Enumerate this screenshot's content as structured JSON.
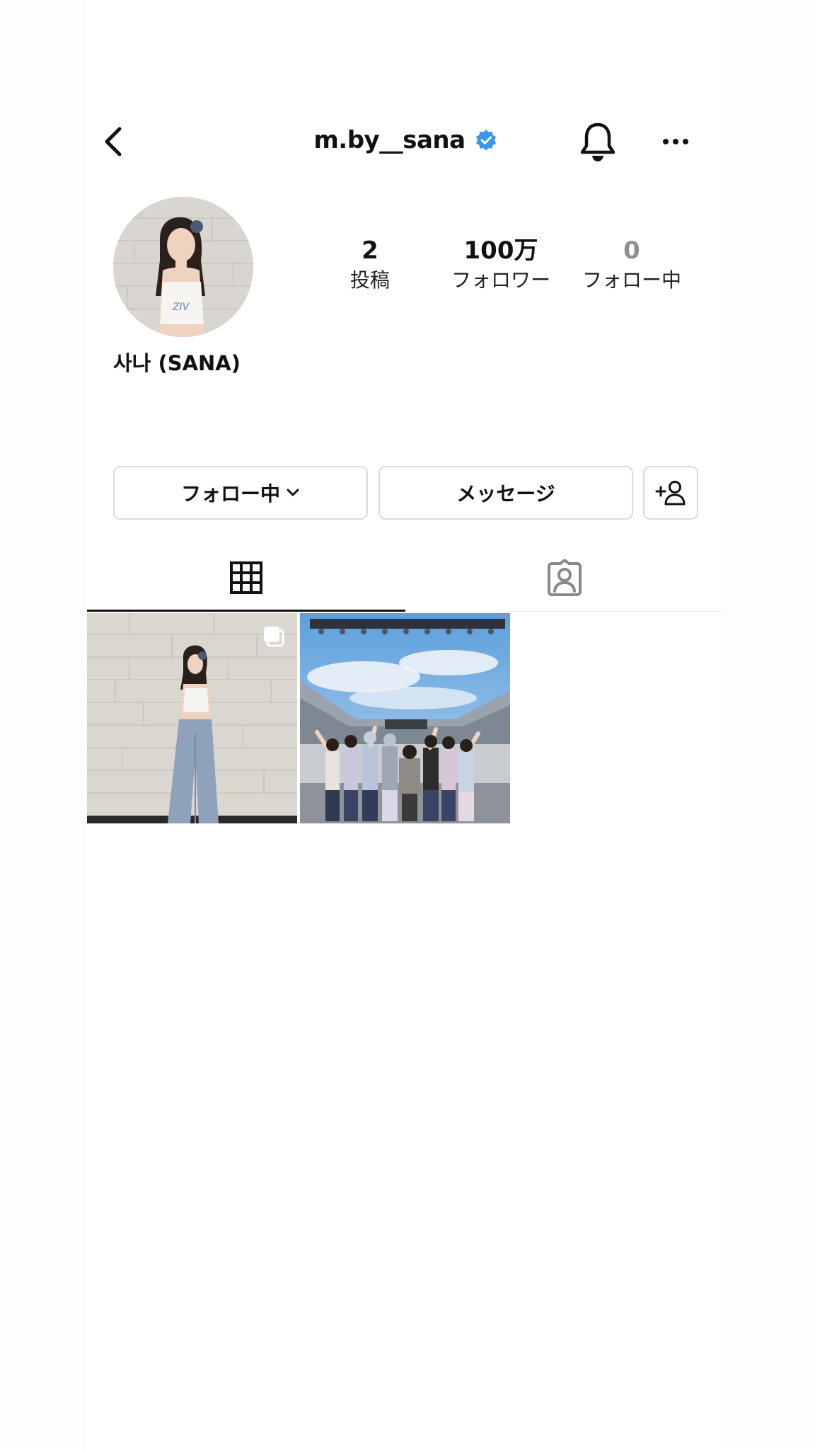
{
  "header": {
    "title": "m.by__sana",
    "verified": true
  },
  "profile": {
    "display_name": "사나 (SANA)",
    "stats": [
      {
        "value": "2",
        "label": "投稿"
      },
      {
        "value": "100万",
        "label": "フォロワー"
      },
      {
        "value": "0",
        "label": "フォロー中"
      }
    ]
  },
  "actions": {
    "follow_label": "フォロー中",
    "message_label": "メッセージ"
  },
  "tabs": {
    "active": "grid"
  },
  "colors": {
    "verified_badge": "#3897f0",
    "border": "#dbdbdb",
    "muted_text": "#8e8e8e"
  }
}
